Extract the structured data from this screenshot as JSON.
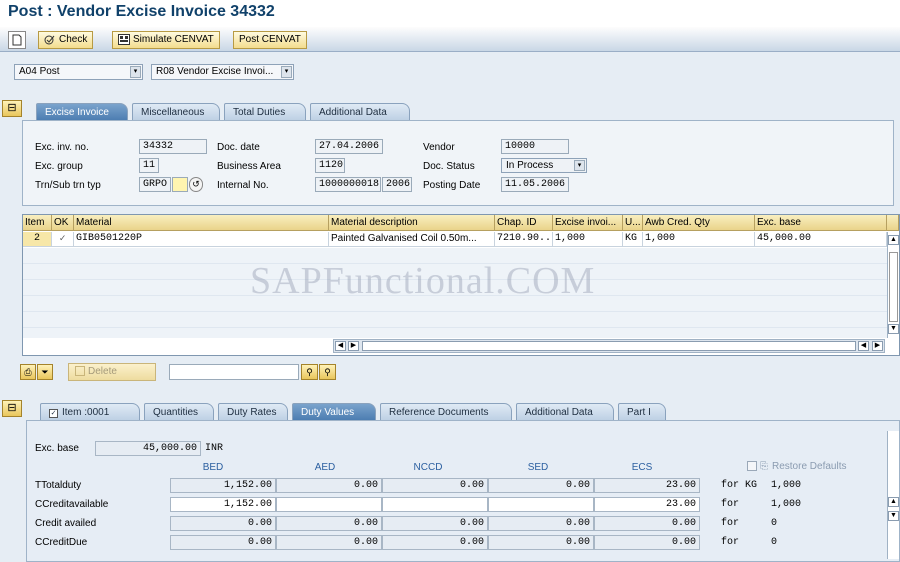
{
  "window": {
    "title": "Post : Vendor Excise Invoice 34332"
  },
  "toolbar": {
    "check": "Check",
    "simulate": "Simulate CENVAT",
    "post": "Post CENVAT"
  },
  "selectors": {
    "action": "A04 Post",
    "ref_doc": "R08 Vendor Excise Invoi..."
  },
  "header_tabs": [
    "Excise Invoice",
    "Miscellaneous",
    "Total Duties",
    "Additional Data"
  ],
  "header": {
    "exc_inv_no_label": "Exc. inv. no.",
    "exc_inv_no": "34332",
    "doc_date_label": "Doc. date",
    "doc_date": "27.04.2006",
    "vendor_label": "Vendor",
    "vendor": "10000",
    "exc_group_label": "Exc. group",
    "exc_group": "11",
    "business_area_label": "Business Area",
    "business_area": "1120",
    "doc_status_label": "Doc. Status",
    "doc_status": "In Process",
    "trn_label": "Trn/Sub trn typ",
    "trn": "GRPO",
    "internal_no_label": "Internal No.",
    "internal_no": "1000000018",
    "internal_year": "2006",
    "posting_date_label": "Posting Date",
    "posting_date": "11.05.2006"
  },
  "items_table": {
    "columns": [
      "Item",
      "OK",
      "Material",
      "Material description",
      "Chap. ID",
      "Excise invoi...",
      "U...",
      "Awb Cred. Qty",
      "Exc. base"
    ],
    "rows": [
      {
        "item": "2",
        "ok": "✓",
        "material": "GIB0501220P",
        "description": "Painted Galvanised Coil 0.50m...",
        "chap_id": "7210.90...",
        "excise_qty": "1,000",
        "unit": "KG",
        "awb_qty": "1,000",
        "exc_base": "45,000.00"
      }
    ]
  },
  "item_actions": {
    "delete": "Delete",
    "search_value": ""
  },
  "watermark": "SAPFunctional.COM",
  "item_tabs": [
    "Item :0001",
    "Quantities",
    "Duty Rates",
    "Duty Values",
    "Reference Documents",
    "Additional Data",
    "Part I"
  ],
  "duty": {
    "exc_base_label": "Exc. base",
    "exc_base": "45,000.00",
    "currency": "INR",
    "columns": [
      "BED",
      "AED",
      "NCCD",
      "SED",
      "ECS"
    ],
    "restore_defaults": "Restore Defaults",
    "rows": [
      {
        "label": "TTotalduty",
        "values": [
          "1,152.00",
          "0.00",
          "0.00",
          "0.00",
          "23.00"
        ],
        "for": "for",
        "unit": "KG",
        "qty": "1,000"
      },
      {
        "label": "CCreditavailable",
        "values": [
          "1,152.00",
          "",
          "",
          "",
          "23.00"
        ],
        "for": "for",
        "unit": "",
        "qty": "1,000"
      },
      {
        "label": "Credit availed",
        "values": [
          "0.00",
          "0.00",
          "0.00",
          "0.00",
          "0.00"
        ],
        "for": "for",
        "unit": "",
        "qty": "0"
      },
      {
        "label": "CCreditDue",
        "values": [
          "0.00",
          "0.00",
          "0.00",
          "0.00",
          "0.00"
        ],
        "for": "for",
        "unit": "",
        "qty": "0"
      }
    ]
  }
}
